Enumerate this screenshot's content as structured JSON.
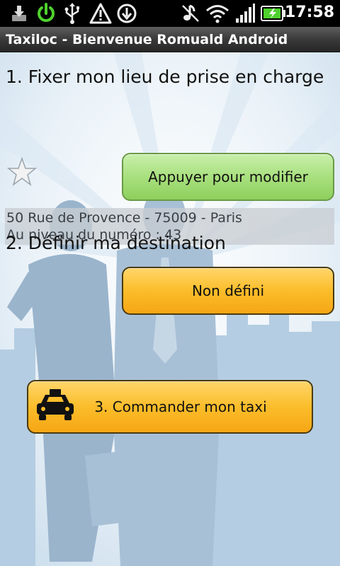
{
  "status_bar": {
    "time": "17:58",
    "icons": [
      "download-icon",
      "power-icon",
      "usb-icon",
      "warning-icon",
      "sync-icon",
      "vibrate-icon",
      "wifi-icon",
      "signal-icon",
      "battery-icon"
    ]
  },
  "title_bar": {
    "title": "Taxiloc - Bienvenue Romuald Android"
  },
  "step1": {
    "heading": "1. Fixer mon lieu de prise en charge",
    "modify_button": "Appuyer pour modifier",
    "favorite_icon": "star-icon",
    "address_line1": "50 Rue de Provence - 75009 - Paris",
    "address_line2": "Au niveau du numéro : 43"
  },
  "step2": {
    "heading": "2. Définir ma destination",
    "destination_button": "Non défini"
  },
  "step3": {
    "order_button": "3. Commander mon taxi",
    "taxi_icon": "taxi-icon"
  },
  "colors": {
    "green_button": "#a9e07e",
    "orange_button": "#fbbd2a",
    "background": "#e9f1f7"
  }
}
